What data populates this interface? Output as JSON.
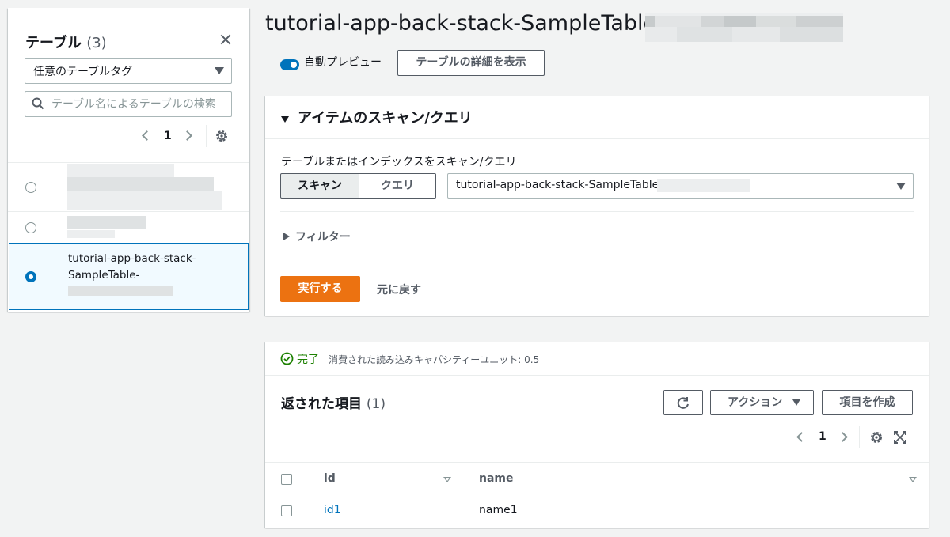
{
  "sidebar": {
    "title": "テーブル",
    "count": "(3)",
    "tag_select": "任意のテーブルタグ",
    "search_placeholder": "テーブル名によるテーブルの検索",
    "page": "1",
    "selected_table": {
      "line1": "tutorial-app-back-stack-",
      "line2": "SampleTable-"
    }
  },
  "main": {
    "title": "tutorial-app-back-stack-SampleTable-",
    "auto_preview": "自動プレビュー",
    "view_details": "テーブルの詳細を表示"
  },
  "scan": {
    "section_title": "アイテムのスキャン/クエリ",
    "label": "テーブルまたはインデックスをスキャン/クエリ",
    "scan_button": "スキャン",
    "query_button": "クエリ",
    "table_select": "tutorial-app-back-stack-SampleTable-",
    "filter_label": "フィルター",
    "run_button": "実行する",
    "reset_button": "元に戻す"
  },
  "results": {
    "status": "完了",
    "rcu": "消費された読み込みキャパシティーユニット: 0.5",
    "title": "返された項目",
    "count": "(1)",
    "actions_button": "アクション",
    "create_button": "項目を作成",
    "page": "1",
    "columns": [
      "id",
      "name"
    ],
    "rows": [
      {
        "id": "id1",
        "name": "name1"
      }
    ]
  },
  "colors": {
    "accent": "#0073bb",
    "primary_button": "#ec7211",
    "success": "#1d8102"
  }
}
